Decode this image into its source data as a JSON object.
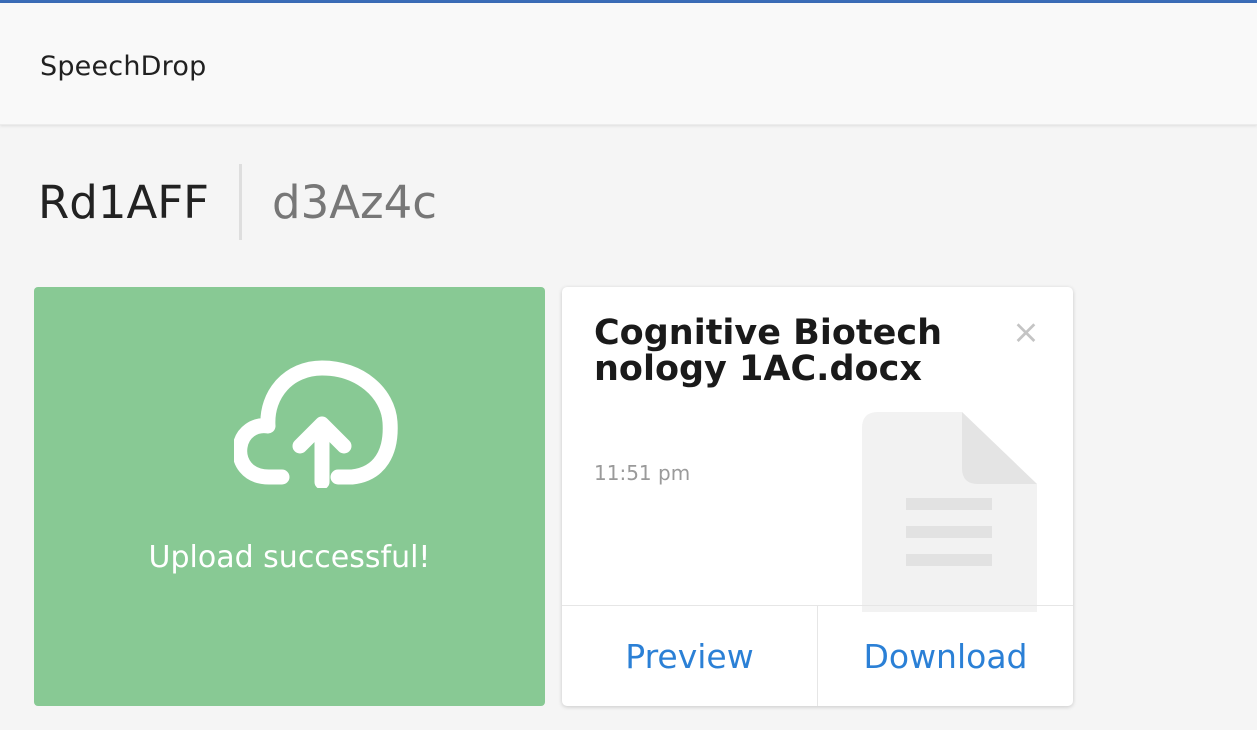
{
  "app": {
    "brand": "SpeechDrop",
    "accent_color": "#3b6db8"
  },
  "room": {
    "name": "Rd1AFF",
    "code": "d3Az4c"
  },
  "upload": {
    "icon": "cloud-upload-icon",
    "message": "Upload successful!",
    "color": "#88c994"
  },
  "files": [
    {
      "name": "Cognitive Biotechnology 1AC.docx",
      "time": "11:51 pm",
      "remove_icon": "×",
      "type_icon": "document-icon",
      "preview_label": "Preview",
      "download_label": "Download",
      "link_color": "#2b80d6"
    }
  ]
}
